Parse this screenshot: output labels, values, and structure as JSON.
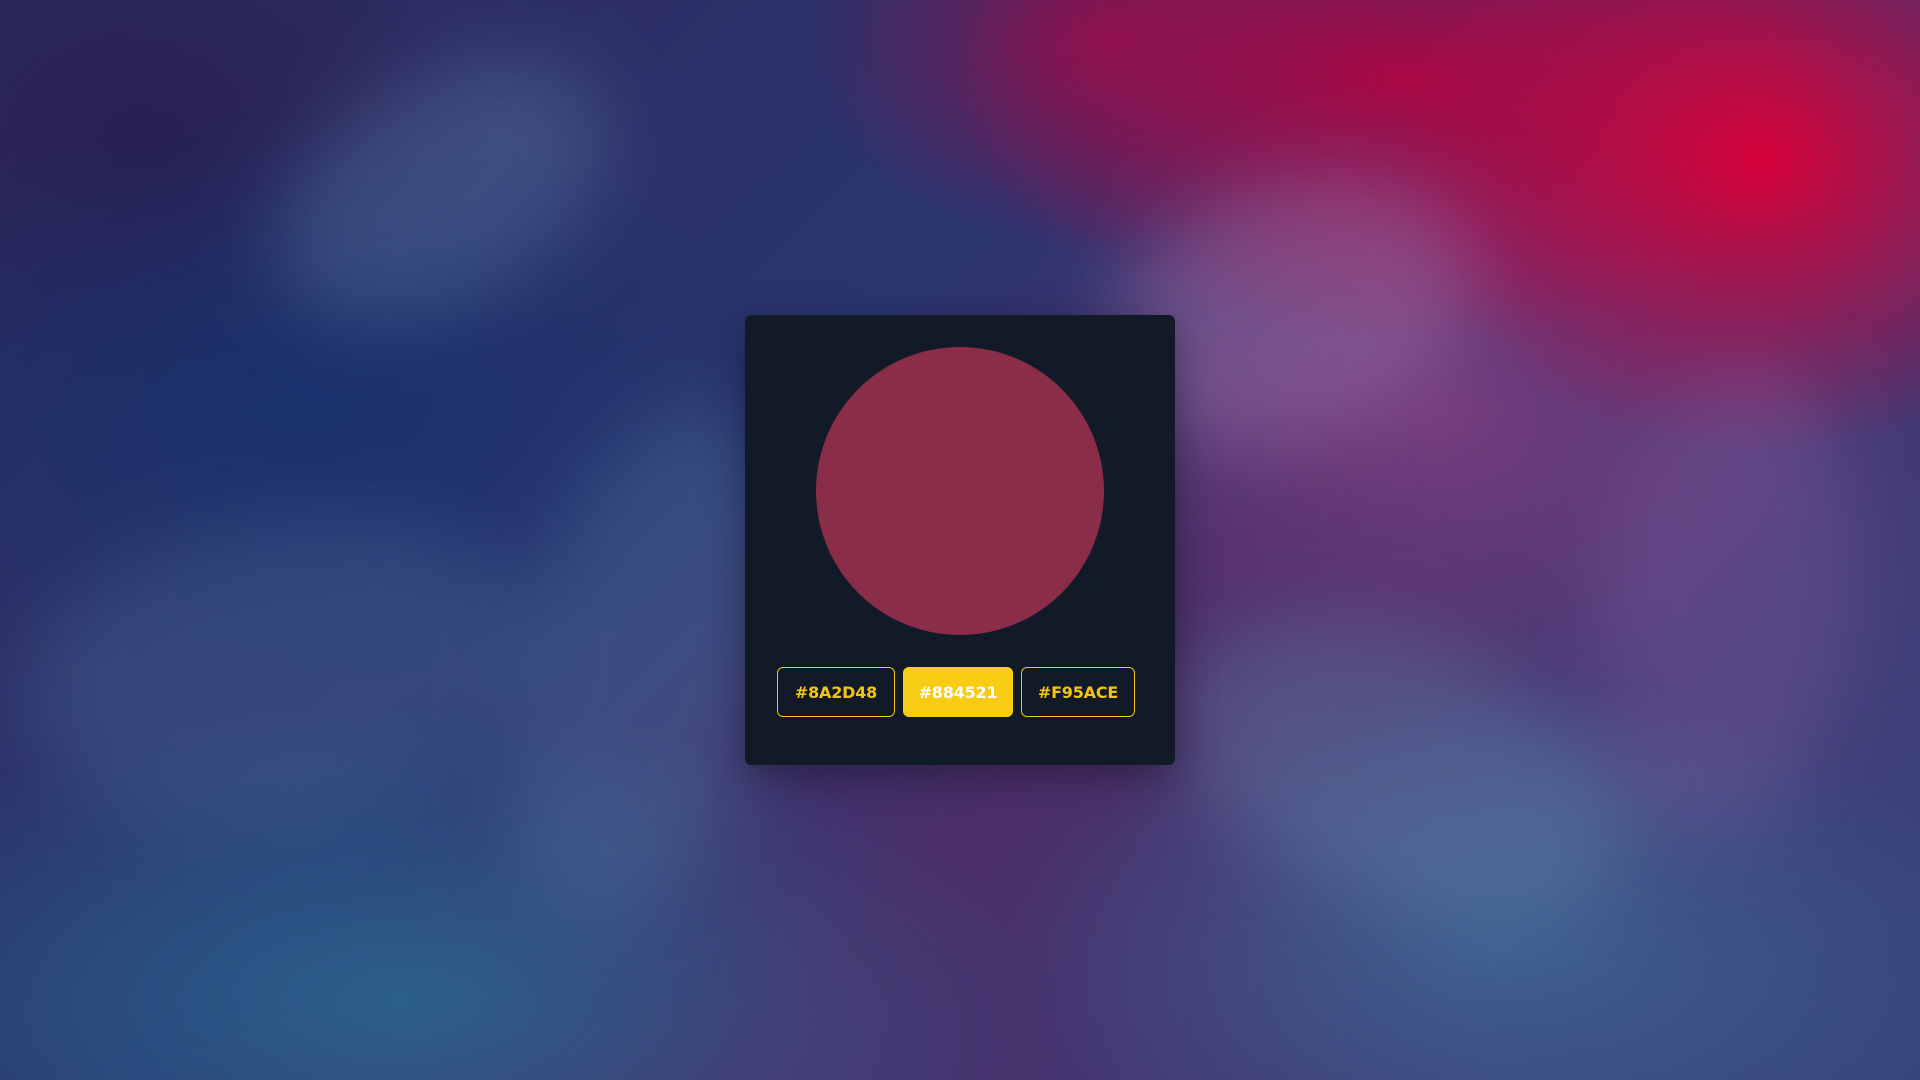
{
  "preview": {
    "current_color": "#8A2D48"
  },
  "options": [
    {
      "label": "#8A2D48",
      "active": false
    },
    {
      "label": "#884521",
      "active": true
    },
    {
      "label": "#F95ACE",
      "active": false
    }
  ],
  "colors": {
    "card_background": "#131A27",
    "accent": "#F8CC15",
    "active_text": "#FFFFFF"
  }
}
